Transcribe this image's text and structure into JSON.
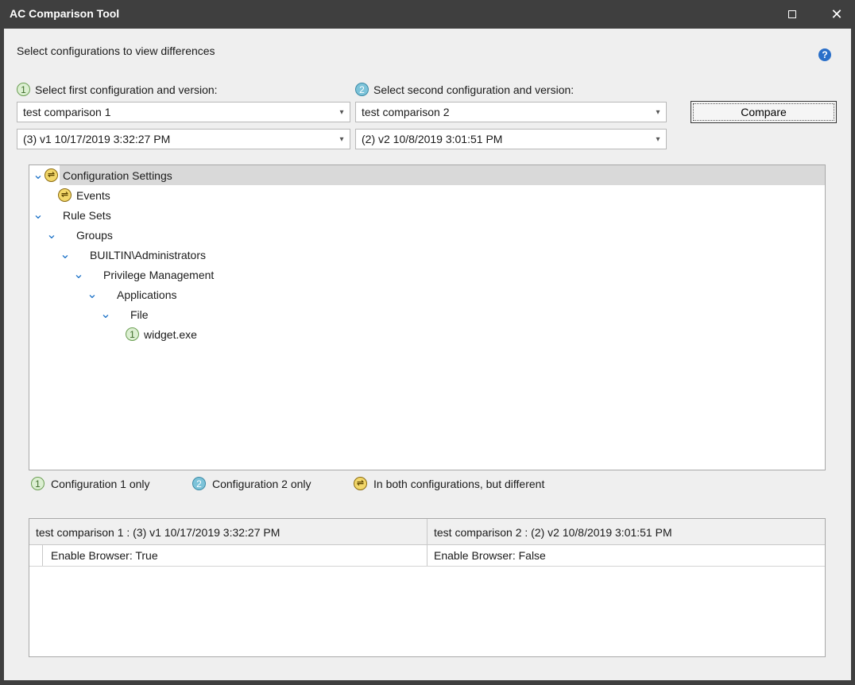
{
  "window": {
    "title": "AC Comparison Tool",
    "close_glyph": "✕"
  },
  "header": {
    "instructions": "Select configurations to view differences",
    "help_glyph": "?"
  },
  "selectors": {
    "first": {
      "badge": "1",
      "label": "Select first configuration and version:",
      "configuration": "test comparison 1",
      "version": "(3) v1 10/17/2019 3:32:27 PM"
    },
    "second": {
      "badge": "2",
      "label": "Select second configuration and version:",
      "configuration": "test comparison 2",
      "version": "(2) v2 10/8/2019 3:01:51 PM"
    },
    "compare_label": "Compare"
  },
  "tree": {
    "nodes": [
      {
        "label": "Configuration Settings",
        "depth": 0,
        "expanded": true,
        "badge": "diff",
        "selected": true
      },
      {
        "label": "Events",
        "depth": 1,
        "expanded": null,
        "badge": "diff",
        "selected": false
      },
      {
        "label": "Rule Sets",
        "depth": 0,
        "expanded": true,
        "badge": null,
        "selected": false
      },
      {
        "label": "Groups",
        "depth": 1,
        "expanded": true,
        "badge": null,
        "selected": false
      },
      {
        "label": "BUILTIN\\Administrators",
        "depth": 2,
        "expanded": true,
        "badge": null,
        "selected": false
      },
      {
        "label": "Privilege Management",
        "depth": 3,
        "expanded": true,
        "badge": null,
        "selected": false
      },
      {
        "label": "Applications",
        "depth": 4,
        "expanded": true,
        "badge": null,
        "selected": false
      },
      {
        "label": "File",
        "depth": 5,
        "expanded": true,
        "badge": null,
        "selected": false
      },
      {
        "label": "widget.exe",
        "depth": 6,
        "expanded": null,
        "badge": "1",
        "selected": false
      }
    ]
  },
  "legend": {
    "config1_badge": "1",
    "config1_label": "Configuration 1 only",
    "config2_badge": "2",
    "config2_label": "Configuration 2 only",
    "diff_label": "In both configurations, but different"
  },
  "grid": {
    "column1": "test comparison 1 : (3) v1 10/17/2019 3:32:27 PM",
    "column2": "test comparison 2 : (2) v2 10/8/2019 3:01:51 PM",
    "rows": [
      {
        "left": "Enable Browser: True",
        "right": "Enable Browser: False"
      }
    ]
  },
  "colors": {
    "titlebar": "#3f3f3f",
    "accent_blue": "#1e73c8",
    "badge_config1": "#dcefd2",
    "badge_config2": "#7cc3d9",
    "badge_diff": "#f2d76a",
    "selected_row": "#d9d9d9"
  },
  "icons": {
    "diff": "swap-arrows-icon",
    "expand": "chevron-down-icon",
    "help": "help-icon",
    "maximize": "maximize-icon",
    "close": "close-icon"
  }
}
